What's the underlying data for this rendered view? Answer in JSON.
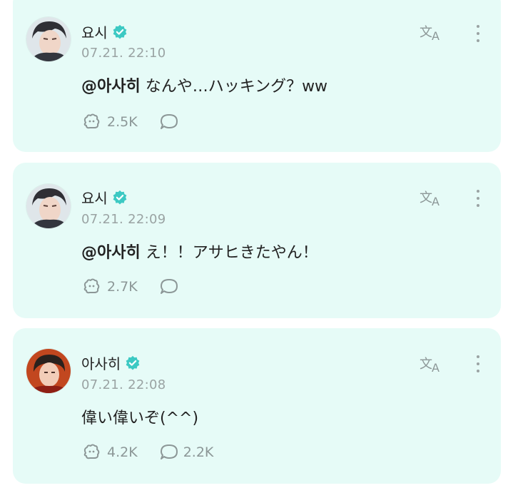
{
  "posts": [
    {
      "author": "요시",
      "time": "07.21. 22:10",
      "mention": "@아사히",
      "text": " なんや…ハッキング？ww",
      "likes": "2.5K",
      "comments": "",
      "avatar_tone": "#3b3f48"
    },
    {
      "author": "요시",
      "time": "07.21. 22:09",
      "mention": "@아사히",
      "text": " え！！アサヒきたやん！",
      "likes": "2.7K",
      "comments": "",
      "avatar_tone": "#3b3f48"
    },
    {
      "author": "아사히",
      "time": "07.21. 22:08",
      "mention": "",
      "text": "偉い偉いぞ(^^)",
      "likes": "4.2K",
      "comments": "2.2K",
      "avatar_tone": "#c2471f"
    }
  ],
  "colors": {
    "card_bg": "#e6fbf7",
    "verified": "#3cc9c3",
    "muted": "#8c9797"
  },
  "icons": {
    "verified": "verified-badge-icon",
    "translate": "translate-icon",
    "more": "more-vertical-icon",
    "like": "bear-paw-icon",
    "comment": "comment-bubble-icon"
  }
}
